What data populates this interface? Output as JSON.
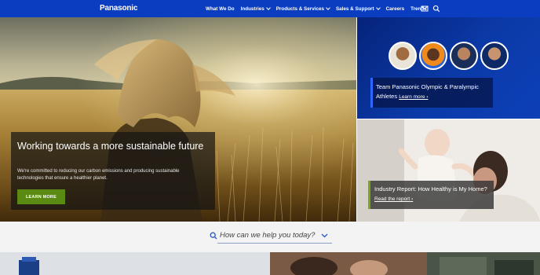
{
  "brand": {
    "logo_text": "Panasonic"
  },
  "nav": {
    "items": [
      {
        "label": "What We Do",
        "dropdown": false
      },
      {
        "label": "Industries",
        "dropdown": true
      },
      {
        "label": "Products & Services",
        "dropdown": true
      },
      {
        "label": "Sales & Support",
        "dropdown": true
      },
      {
        "label": "Careers",
        "dropdown": false
      },
      {
        "label": "Trends",
        "dropdown": false
      }
    ],
    "icons": [
      "mail-icon",
      "search-icon"
    ]
  },
  "hero": {
    "title": "Working towards a more sustainable future",
    "text": "We're committed to reducing our carbon emissions and producing sustainable technologies that ensure a healthier planet.",
    "button_label": "LEARN MORE"
  },
  "athletes_panel": {
    "title": "Team Panasonic Olympic & Paralympic Athletes",
    "link_label": "Learn more"
  },
  "report_panel": {
    "title": "Industry Report: How Healthy is My Home?",
    "link_label": "Read the report"
  },
  "help": {
    "prompt": "How can we help you today?"
  },
  "colors": {
    "nav_blue": "#0a3dbf",
    "button_green": "#5a8a12",
    "athlete_accent": "#2e66ff",
    "report_accent": "#7aa619"
  }
}
